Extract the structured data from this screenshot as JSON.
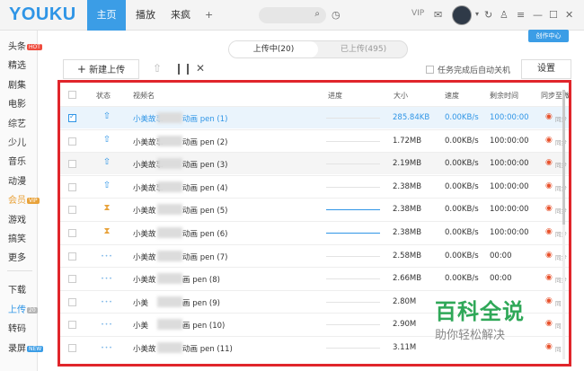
{
  "app": {
    "logo": "YOUKU"
  },
  "topnav": {
    "tabs": [
      {
        "label": "主页",
        "active": true
      },
      {
        "label": "播放",
        "active": false
      },
      {
        "label": "来疯",
        "active": false
      }
    ],
    "vip_label": "VIP"
  },
  "sidebar": {
    "items": [
      {
        "label": "头条",
        "badge": "HOT",
        "badge_color": "#ef4c3e"
      },
      {
        "label": "精选"
      },
      {
        "label": "剧集"
      },
      {
        "label": "电影"
      },
      {
        "label": "综艺"
      },
      {
        "label": "少儿"
      },
      {
        "label": "音乐"
      },
      {
        "label": "动漫"
      },
      {
        "label": "会员",
        "badge": "VIP",
        "badge_color": "#e8a23a"
      },
      {
        "label": "游戏"
      },
      {
        "label": "搞笑"
      },
      {
        "label": "更多"
      }
    ],
    "bottom_items": [
      {
        "label": "下载"
      },
      {
        "label": "上传",
        "badge": "20",
        "badge_color": "#b5b5b5",
        "active": true
      },
      {
        "label": "转码"
      },
      {
        "label": "录屏",
        "badge": "NEW",
        "badge_color": "#3b9de6"
      }
    ]
  },
  "creator_center": "创作中心",
  "segment": {
    "uploading": "上传中(20)",
    "uploaded": "已上传(495)"
  },
  "toolbar": {
    "new_upload": "新建上传",
    "auto_shutdown": "任务完成后自动关机",
    "settings": "设置"
  },
  "table": {
    "headers": {
      "status": "状态",
      "name": "视频名",
      "progress": "进度",
      "size": "大小",
      "speed": "速度",
      "remaining": "剩余时间",
      "sync": "同步至微"
    },
    "rows": [
      {
        "prefix": "小美故事",
        "suffix": "动画 pen (1)",
        "size": "285.84KB",
        "speed": "0.00KB/s",
        "remaining": "100:00:00",
        "status": "upload",
        "progress": 0,
        "selected": true,
        "sync": "同步",
        "blue": true
      },
      {
        "prefix": "小美故事",
        "suffix": "动画 pen (2)",
        "size": "1.72MB",
        "speed": "0.00KB/s",
        "remaining": "100:00:00",
        "status": "upload",
        "progress": 0,
        "sync": "同步"
      },
      {
        "prefix": "小美故事",
        "suffix": "动画 pen (3)",
        "size": "2.19MB",
        "speed": "0.00KB/s",
        "remaining": "100:00:00",
        "status": "upload",
        "progress": 0,
        "highlight": true,
        "sync": "同步"
      },
      {
        "prefix": "小美故事",
        "suffix": "动画 pen (4)",
        "size": "2.38MB",
        "speed": "0.00KB/s",
        "remaining": "100:00:00",
        "status": "upload",
        "progress": 0,
        "sync": "同步"
      },
      {
        "prefix": "小美故",
        "suffix": "动画 pen (5)",
        "size": "2.38MB",
        "speed": "0.00KB/s",
        "remaining": "100:00:00",
        "status": "wait",
        "progress": 100,
        "sync": "同步"
      },
      {
        "prefix": "小美故",
        "suffix": "动画 pen (6)",
        "size": "2.38MB",
        "speed": "0.00KB/s",
        "remaining": "100:00:00",
        "status": "wait",
        "progress": 100,
        "sync": "同步"
      },
      {
        "prefix": "小美故",
        "suffix": "动画 pen (7)",
        "size": "2.58MB",
        "speed": "0.00KB/s",
        "remaining": "00:00",
        "status": "queue",
        "progress": 0,
        "sync": "同步"
      },
      {
        "prefix": "小美故",
        "suffix": "画 pen (8)",
        "size": "2.66MB",
        "speed": "0.00KB/s",
        "remaining": "00:00",
        "status": "queue",
        "progress": 0,
        "sync": "同步"
      },
      {
        "prefix": "小美",
        "suffix": "画 pen (9)",
        "size": "2.80M",
        "speed": "",
        "remaining": "",
        "status": "queue",
        "progress": 0,
        "sync": "同"
      },
      {
        "prefix": "小美",
        "suffix": "画 pen (10)",
        "size": "2.90M",
        "speed": "",
        "remaining": "",
        "status": "queue",
        "progress": 0,
        "sync": "同"
      },
      {
        "prefix": "小美故",
        "suffix": "动画 pen (11)",
        "size": "3.11M",
        "speed": "",
        "remaining": "",
        "status": "queue",
        "progress": 0,
        "sync": "同"
      }
    ]
  },
  "watermark": {
    "title": "百科全说",
    "subtitle": "助你轻松解决"
  },
  "colors": {
    "accent": "#3b9de6",
    "frame": "#e0252b",
    "watermark": "#2fa858"
  }
}
